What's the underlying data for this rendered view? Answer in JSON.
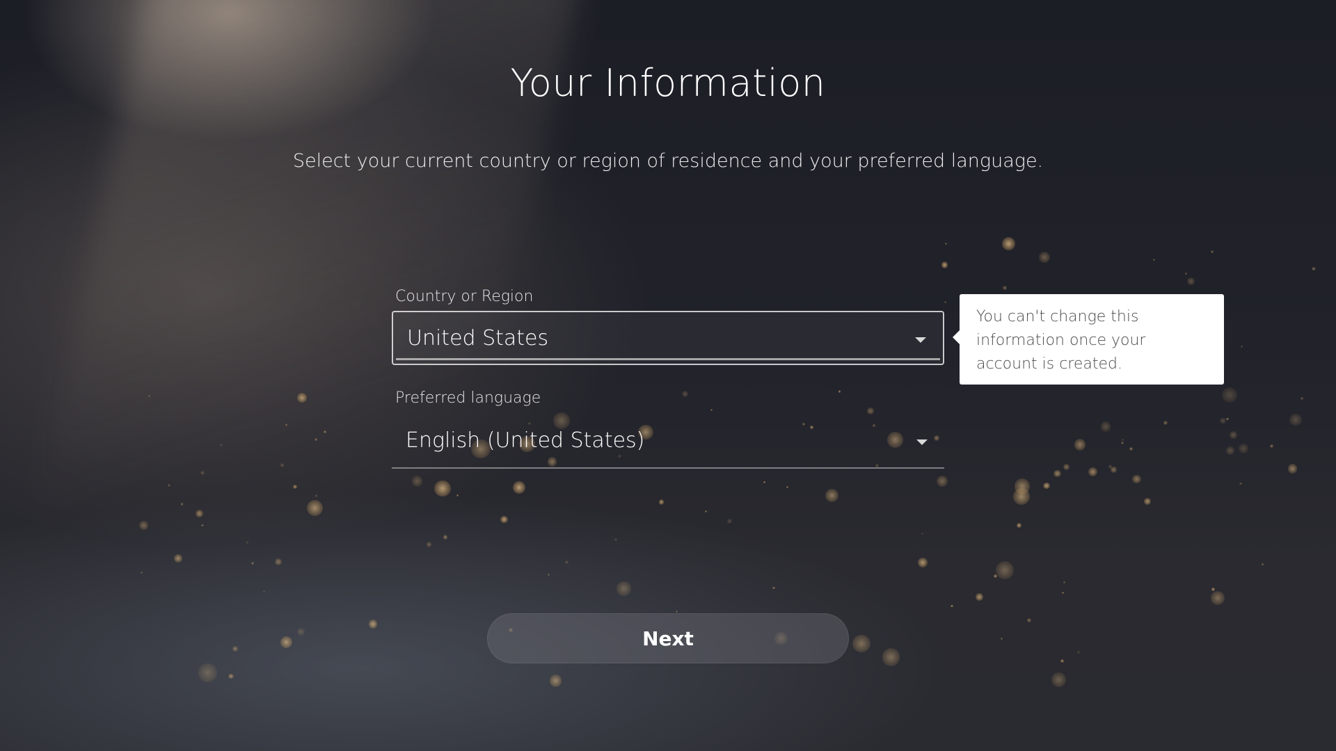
{
  "page": {
    "title": "Your Information",
    "subtitle": "Select your current country or region of residence and your preferred language."
  },
  "country_field": {
    "label": "Country or Region",
    "value": "United States",
    "focused": true
  },
  "language_field": {
    "label": "Preferred language",
    "value": "English (United States)"
  },
  "tooltip": {
    "text": "You can't change this information once your account is created."
  },
  "actions": {
    "next_label": "Next"
  },
  "icons": {
    "dropdown": "chevron-down-icon"
  },
  "colors": {
    "background": "#20222a",
    "tooltip_bg": "#ffffff",
    "tooltip_text": "#4a4a4a",
    "particle": "#e6b878"
  }
}
